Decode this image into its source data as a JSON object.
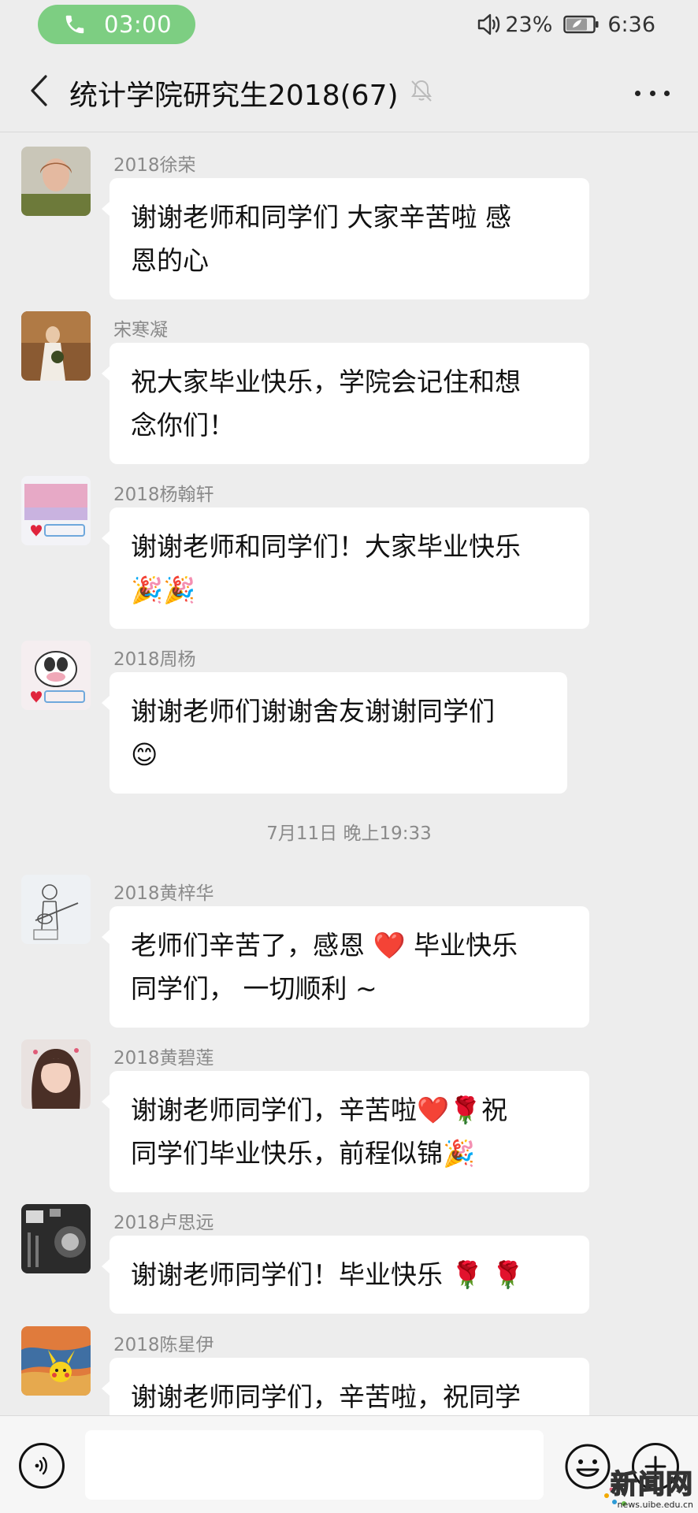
{
  "status_bar": {
    "call_time": "03:00",
    "battery_percent": "23%",
    "clock": "6:36"
  },
  "header": {
    "title": "统计学院研究生2018(67)"
  },
  "messages": [
    {
      "sender": "2018徐荣",
      "lines": [
        "谢谢老师和同学们 大家辛苦啦 感",
        "恩的心"
      ]
    },
    {
      "sender": "宋寒凝",
      "lines": [
        "祝大家毕业快乐，学院会记住和想",
        "念你们！"
      ]
    },
    {
      "sender": "2018杨翰轩",
      "lines": [
        "谢谢老师和同学们！大家毕业快乐",
        "🎉🎉"
      ]
    },
    {
      "sender": "2018周杨",
      "lines": [
        "谢谢老师们谢谢舍友谢谢同学们",
        "😊"
      ]
    },
    {
      "sender": "2018黄梓华",
      "lines": [
        "老师们辛苦了，感恩 ❤️ 毕业快乐",
        "同学们，  一切顺利 ~"
      ]
    },
    {
      "sender": "2018黄碧莲",
      "lines": [
        "谢谢老师同学们，辛苦啦❤️🌹祝",
        "同学们毕业快乐，前程似锦🎉"
      ]
    },
    {
      "sender": "2018卢思远",
      "lines": [
        "谢谢老师同学们！毕业快乐 🌹 🌹"
      ]
    },
    {
      "sender": "2018陈星伊",
      "lines": [
        "谢谢老师同学们，辛苦啦，祝同学"
      ]
    }
  ],
  "time_divider": "7月11日 晚上19:33",
  "avatars": [
    "green-top-portrait",
    "bride-portrait",
    "uibe-pink-badge",
    "uibe-cartoon-badge",
    "guitar-sketch",
    "smiling-girl",
    "monochrome-photo",
    "pikachu-scream"
  ],
  "watermark": {
    "big": "新闻网",
    "small": "news.uibe.edu.cn"
  },
  "colors": {
    "call_green": "#7dce82",
    "background": "#ededed",
    "bubble": "#ffffff",
    "sender_gray": "#8a8a8a"
  }
}
